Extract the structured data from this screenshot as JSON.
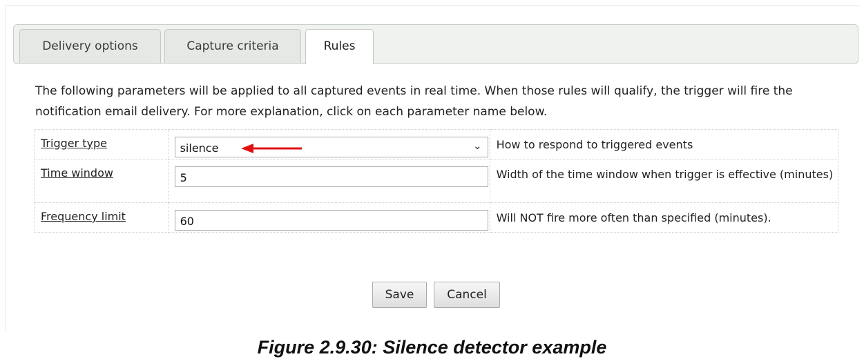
{
  "tabs": [
    {
      "label": "Delivery options"
    },
    {
      "label": "Capture criteria"
    },
    {
      "label": "Rules",
      "active": true
    }
  ],
  "intro_text": "The following parameters will be applied to all captured events in real time. When those rules will qualify, the trigger will fire the notification email delivery. For more explanation, click on each parameter name below.",
  "params": [
    {
      "label": "Trigger type",
      "value": "silence",
      "control": "select",
      "description": "How to respond to triggered events"
    },
    {
      "label": "Time window",
      "value": "5",
      "control": "text",
      "description": "Width of the time window when trigger is effective (minutes)"
    },
    {
      "label": "Frequency limit",
      "value": "60",
      "control": "text",
      "description": "Will NOT fire more often than specified (minutes)."
    }
  ],
  "buttons": {
    "save": "Save",
    "cancel": "Cancel"
  },
  "caption": "Figure 2.9.30: Silence detector example",
  "icons": {
    "select_chevron": "chevron-down-icon",
    "annotation": "red-arrow-icon"
  },
  "colors": {
    "arrow": "#e01010",
    "tab_bar": "#f0f2f0"
  }
}
